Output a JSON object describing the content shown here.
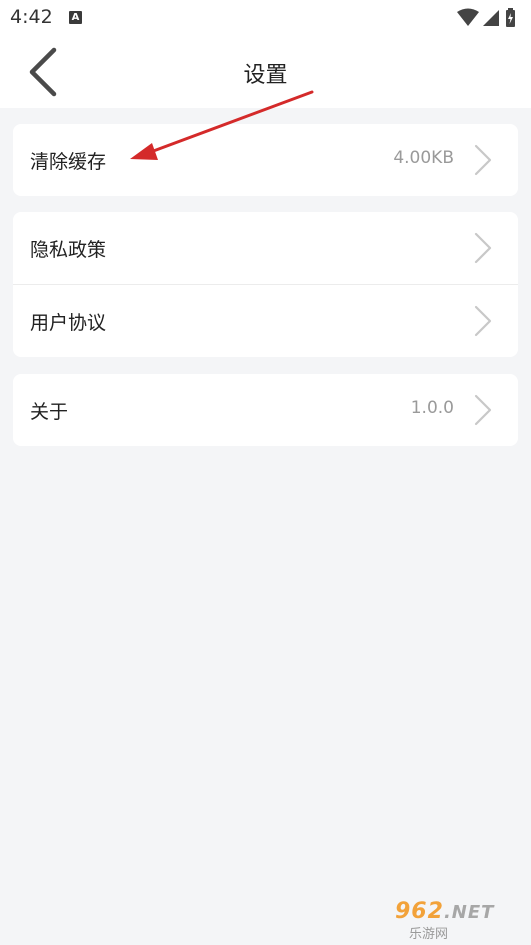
{
  "status_bar": {
    "time": "4:42",
    "notification_icon": "a-icon",
    "icons": [
      "wifi-icon",
      "signal-icon",
      "battery-charging-icon"
    ]
  },
  "header": {
    "title": "设置",
    "back_icon": "chevron-left-icon"
  },
  "groups": [
    {
      "items": [
        {
          "label": "清除缓存",
          "value": "4.00KB"
        }
      ]
    },
    {
      "items": [
        {
          "label": "隐私政策",
          "value": ""
        },
        {
          "label": "用户协议",
          "value": ""
        }
      ]
    },
    {
      "items": [
        {
          "label": "关于",
          "value": "1.0.0"
        }
      ]
    }
  ],
  "annotation": {
    "type": "red-arrow",
    "color": "#d42a2a"
  },
  "watermark": {
    "top": "962",
    "top_suffix": ".NET",
    "bottom": "乐游网"
  },
  "colors": {
    "background": "#f4f5f7",
    "card": "#ffffff",
    "value_text": "#9a9a9a",
    "chevron": "#c8c8c8"
  }
}
